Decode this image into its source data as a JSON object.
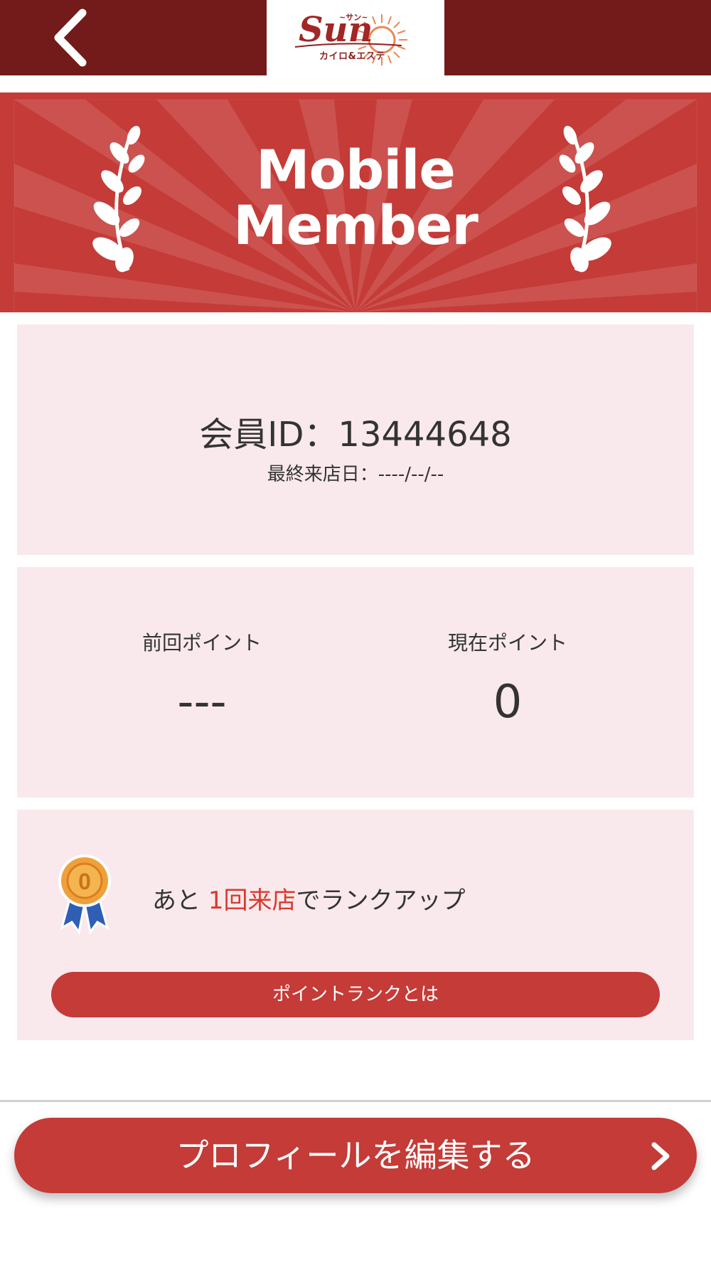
{
  "header": {
    "back_icon": "chevron-left-icon",
    "logo": {
      "text": "Sun",
      "top_text": "~サン~",
      "sub_text": "カイロ&エステ"
    },
    "background": "#731a1a"
  },
  "banner": {
    "title_line1": "Mobile",
    "title_line2": "Member",
    "background": "#c43b37"
  },
  "member": {
    "id_text": "会員ID：13444648",
    "last_visit_text": "最終来店日：----/--/--"
  },
  "points": {
    "previous_label": "前回ポイント",
    "previous_value": "---",
    "current_label": "現在ポイント",
    "current_value": "0"
  },
  "rank": {
    "medal_icon": "bronze-medal-icon",
    "medal_number": "0",
    "text_before": "あと ",
    "text_highlight": "1回来店",
    "text_after": "でランクアップ",
    "button_label": "ポイントランクとは"
  },
  "footer": {
    "edit_profile_label": "プロフィールを編集する",
    "chevron_icon": "chevron-right-icon"
  },
  "colors": {
    "accent": "#c43b37",
    "panel": "#fae9ec",
    "highlight": "#d73a2e"
  }
}
